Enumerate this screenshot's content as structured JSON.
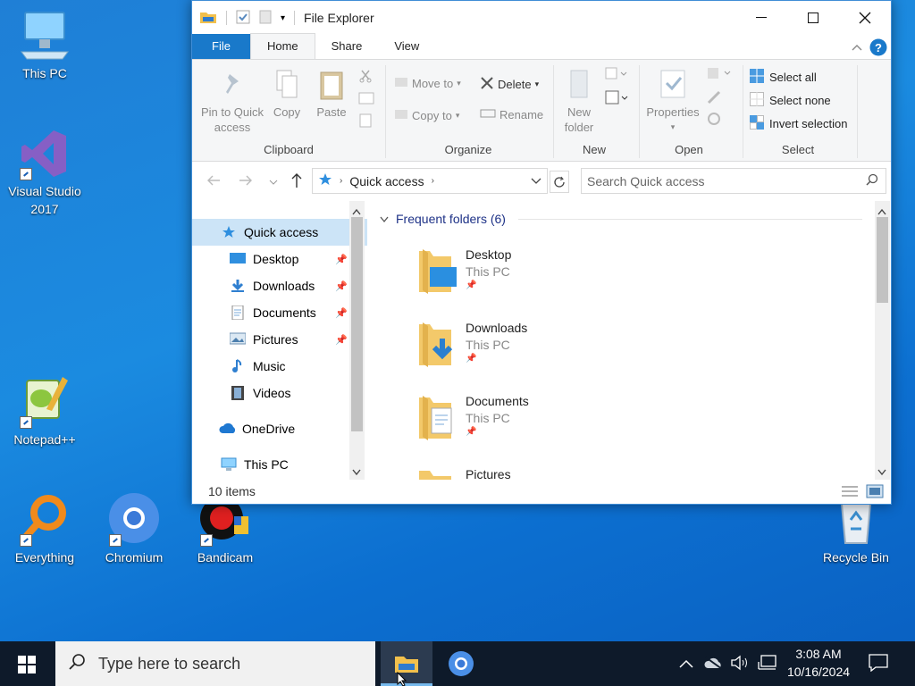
{
  "desktop": {
    "icons": [
      {
        "label": "This PC"
      },
      {
        "label": "Visual Studio 2017"
      },
      {
        "label": "Notepad++"
      },
      {
        "label": "Everything"
      },
      {
        "label": "Chromium"
      },
      {
        "label": "Bandicam"
      },
      {
        "label": "Recycle Bin"
      }
    ]
  },
  "window": {
    "title": "File Explorer",
    "tabs": [
      "File",
      "Home",
      "Share",
      "View"
    ],
    "ribbon": {
      "clipboard": {
        "label": "Clipboard",
        "pin": "Pin to Quick access",
        "copy": "Copy",
        "paste": "Paste"
      },
      "organize": {
        "label": "Organize",
        "move": "Move to",
        "copy_to": "Copy to",
        "delete": "Delete",
        "rename": "Rename"
      },
      "new": {
        "label": "New",
        "new_folder": "New folder"
      },
      "open": {
        "label": "Open",
        "properties": "Properties"
      },
      "select": {
        "label": "Select",
        "select_all": "Select all",
        "select_none": "Select none",
        "invert": "Invert selection"
      }
    },
    "address": {
      "path": "Quick access",
      "search_placeholder": "Search Quick access"
    },
    "nav": {
      "items": [
        {
          "label": "Quick access"
        },
        {
          "label": "Desktop"
        },
        {
          "label": "Downloads"
        },
        {
          "label": "Documents"
        },
        {
          "label": "Pictures"
        },
        {
          "label": "Music"
        },
        {
          "label": "Videos"
        },
        {
          "label": "OneDrive"
        },
        {
          "label": "This PC"
        }
      ]
    },
    "content": {
      "group_header": "Frequent folders (6)",
      "folders": [
        {
          "name": "Desktop",
          "location": "This PC"
        },
        {
          "name": "Downloads",
          "location": "This PC"
        },
        {
          "name": "Documents",
          "location": "This PC"
        },
        {
          "name": "Pictures",
          "location": ""
        }
      ]
    },
    "status": {
      "items": "10 items"
    }
  },
  "taskbar": {
    "search_placeholder": "Type here to search",
    "time": "3:08 AM",
    "date": "10/16/2024"
  },
  "colors": {
    "accent": "#1979ca",
    "desktop": "#1b8be0",
    "taskbar": "#0e1a2a",
    "folder": "#f3c96a"
  }
}
